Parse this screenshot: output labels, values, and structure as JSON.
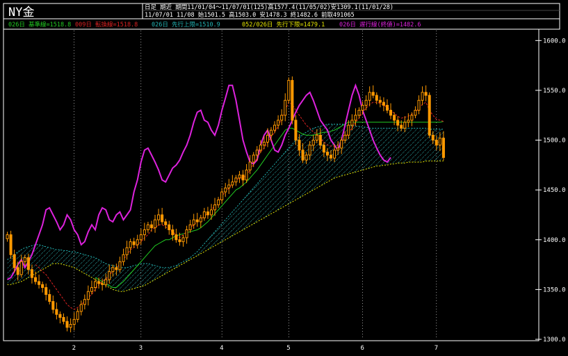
{
  "header": {
    "symbol": "NY金",
    "line1": "日足 期近 期間11/01/04～11/07/01(125)高1577.4(11/05/02)安1309.1(11/01/28)",
    "line2": "11/07/01 11/08 始1501.5 高1503.0 安1478.3 終1482.6 前取491065"
  },
  "legend": [
    {
      "text": "026日 基準線=1518.8",
      "color": "#22cc22"
    },
    {
      "text": "009日 転換線=1518.8",
      "color": "#dd2222"
    },
    {
      "text": "026日 先行上限=1510.9",
      "color": "#22b5b5"
    },
    {
      "text": "052/026日 先行下限=1479.1",
      "color": "#e6e600"
    },
    {
      "text": "026日 遅行線(終値)=1482.6",
      "color": "#dd22dd"
    }
  ],
  "colors": {
    "candle": "#ff9900",
    "kijun": "#22cc22",
    "tenkan": "#dd2222",
    "senkou_a": "#22b5b5",
    "senkou_b": "#e6e600",
    "chikou": "#dd22dd",
    "cloud": "#33bbbb",
    "axis": "#ffffff",
    "grid": "#ffffff"
  },
  "chart_data": {
    "type": "candlestick",
    "ylim": [
      1300,
      1610
    ],
    "y_ticks": [
      1300,
      1350,
      1400,
      1450,
      1500,
      1550,
      1600
    ],
    "y_tick_labels": [
      "1300.0",
      "1350.0",
      "1400.0",
      "1450.0",
      "1500.0",
      "1550.0",
      "1600.0"
    ],
    "x_ticks": [
      {
        "index": 19,
        "label": "2"
      },
      {
        "index": 38,
        "label": "3"
      },
      {
        "index": 61,
        "label": "4"
      },
      {
        "index": 80,
        "label": "5"
      },
      {
        "index": 101,
        "label": "6"
      },
      {
        "index": 122,
        "label": "7"
      }
    ],
    "total_bars": 151,
    "closes": [
      1405,
      1385,
      1372,
      1365,
      1378,
      1382,
      1370,
      1362,
      1358,
      1355,
      1352,
      1345,
      1338,
      1330,
      1325,
      1322,
      1318,
      1312,
      1315,
      1320,
      1328,
      1335,
      1340,
      1348,
      1352,
      1358,
      1356,
      1355,
      1360,
      1368,
      1372,
      1370,
      1378,
      1385,
      1392,
      1398,
      1395,
      1400,
      1405,
      1410,
      1415,
      1412,
      1420,
      1425,
      1418,
      1415,
      1410,
      1405,
      1400,
      1398,
      1402,
      1410,
      1415,
      1420,
      1418,
      1422,
      1428,
      1425,
      1430,
      1435,
      1440,
      1448,
      1452,
      1455,
      1458,
      1462,
      1465,
      1460,
      1470,
      1478,
      1485,
      1490,
      1495,
      1498,
      1505,
      1510,
      1515,
      1520,
      1525,
      1540,
      1560,
      1520,
      1500,
      1490,
      1480,
      1485,
      1495,
      1500,
      1505,
      1495,
      1488,
      1485,
      1482,
      1490,
      1492,
      1500,
      1505,
      1515,
      1520,
      1525,
      1530,
      1535,
      1540,
      1548,
      1545,
      1540,
      1538,
      1535,
      1530,
      1525,
      1520,
      1515,
      1512,
      1518,
      1520,
      1525,
      1530,
      1540,
      1548,
      1545,
      1505,
      1500,
      1495,
      1502,
      1482.6
    ],
    "tenkan": [
      null,
      null,
      null,
      null,
      null,
      null,
      null,
      null,
      1375,
      1372,
      1368,
      1365,
      1360,
      1355,
      1350,
      1345,
      1340,
      1335,
      1332,
      1330,
      1332,
      1335,
      1338,
      1342,
      1345,
      1350,
      1355,
      1358,
      1360,
      1365,
      1368,
      1372,
      1375,
      1380,
      1385,
      1390,
      1392,
      1395,
      1398,
      1402,
      1405,
      1410,
      1412,
      1415,
      1415,
      1413,
      1410,
      1408,
      1405,
      1402,
      1405,
      1408,
      1412,
      1415,
      1418,
      1420,
      1424,
      1426,
      1430,
      1434,
      1438,
      1444,
      1448,
      1452,
      1456,
      1460,
      1462,
      1462,
      1465,
      1470,
      1476,
      1482,
      1488,
      1492,
      1498,
      1503,
      1508,
      1514,
      1522,
      1530,
      1538,
      1536,
      1530,
      1525,
      1520,
      1515,
      1512,
      1508,
      1506,
      1502,
      1498,
      1495,
      1494,
      1494,
      1495,
      1498,
      1502,
      1508,
      1512,
      1518,
      1522,
      1528,
      1532,
      1536,
      1538,
      1538,
      1537,
      1535,
      1533,
      1530,
      1527,
      1524,
      1522,
      1523,
      1524,
      1526,
      1528,
      1532,
      1536,
      1538,
      1530,
      1525,
      1521,
      1520,
      1518.8
    ],
    "kijun": [
      null,
      null,
      null,
      null,
      null,
      null,
      null,
      null,
      null,
      null,
      null,
      null,
      null,
      null,
      null,
      null,
      null,
      null,
      null,
      null,
      null,
      null,
      null,
      null,
      null,
      1362,
      1360,
      1358,
      1356,
      1354,
      1352,
      1352,
      1355,
      1358,
      1362,
      1366,
      1370,
      1374,
      1378,
      1382,
      1386,
      1390,
      1394,
      1396,
      1398,
      1400,
      1400,
      1402,
      1404,
      1405,
      1406,
      1407,
      1408,
      1409,
      1410,
      1412,
      1415,
      1418,
      1422,
      1426,
      1430,
      1434,
      1438,
      1442,
      1446,
      1450,
      1452,
      1455,
      1458,
      1462,
      1466,
      1470,
      1475,
      1480,
      1485,
      1490,
      1495,
      1500,
      1505,
      1510,
      1512,
      1512,
      1510,
      1508,
      1506,
      1505,
      1505,
      1505,
      1506,
      1507,
      1508,
      1508,
      1509,
      1510,
      1512,
      1514,
      1516,
      1518,
      1518,
      1518,
      1518,
      1518,
      1518,
      1518,
      1518,
      1518,
      1518,
      1518,
      1518,
      1518,
      1518,
      1518,
      1518,
      1518,
      1518,
      1518,
      1518,
      1518,
      1518,
      1518,
      1518,
      1518,
      1518,
      1518,
      1518.8
    ],
    "senkou_a": [
      1380,
      1382,
      1385,
      1388,
      1390,
      1392,
      1393,
      1394,
      1395,
      1395,
      1394,
      1393,
      1392,
      1391,
      1390,
      1390,
      1389,
      1389,
      1388,
      1388,
      1387,
      1386,
      1385,
      1384,
      1383,
      1382,
      1380,
      1378,
      1376,
      1375,
      1374,
      1373,
      1372,
      1372,
      1372,
      1373,
      1374,
      1375,
      1376,
      1376,
      1376,
      1375,
      1374,
      1373,
      1372,
      1372,
      1372,
      1373,
      1374,
      1376,
      1378,
      1380,
      1382,
      1385,
      1388,
      1392,
      1396,
      1400,
      1404,
      1408,
      1412,
      1416,
      1420,
      1424,
      1428,
      1432,
      1436,
      1440,
      1444,
      1448,
      1452,
      1456,
      1460,
      1464,
      1468,
      1472,
      1476,
      1480,
      1484,
      1488,
      1492,
      1496,
      1500,
      1503,
      1506,
      1508,
      1510,
      1512,
      1513,
      1514,
      1515,
      1516,
      1516,
      1516,
      1516,
      1516,
      1516,
      1515,
      1515,
      1514,
      1514,
      1513,
      1513,
      1512,
      1512,
      1512,
      1512,
      1512,
      1512,
      1512,
      1512,
      1512,
      1512,
      1512,
      1512,
      1512,
      1512,
      1512,
      1512,
      1512,
      1511,
      1511,
      1511,
      1511,
      1510.9
    ],
    "senkou_b": [
      1355,
      1355,
      1356,
      1357,
      1358,
      1360,
      1362,
      1364,
      1366,
      1368,
      1370,
      1372,
      1374,
      1376,
      1376,
      1376,
      1375,
      1374,
      1373,
      1372,
      1370,
      1368,
      1366,
      1364,
      1362,
      1360,
      1358,
      1356,
      1354,
      1352,
      1350,
      1349,
      1348,
      1348,
      1349,
      1350,
      1351,
      1352,
      1353,
      1354,
      1356,
      1358,
      1360,
      1362,
      1364,
      1366,
      1368,
      1370,
      1372,
      1374,
      1376,
      1378,
      1380,
      1382,
      1384,
      1386,
      1388,
      1390,
      1392,
      1394,
      1396,
      1398,
      1400,
      1402,
      1404,
      1406,
      1408,
      1410,
      1412,
      1414,
      1416,
      1418,
      1420,
      1422,
      1424,
      1426,
      1428,
      1430,
      1432,
      1434,
      1436,
      1438,
      1440,
      1442,
      1444,
      1446,
      1448,
      1450,
      1452,
      1454,
      1456,
      1458,
      1460,
      1462,
      1463,
      1464,
      1465,
      1466,
      1467,
      1468,
      1469,
      1470,
      1471,
      1472,
      1473,
      1474,
      1474,
      1475,
      1475,
      1476,
      1476,
      1477,
      1477,
      1477,
      1478,
      1478,
      1478,
      1478,
      1478,
      1479,
      1479,
      1479,
      1479,
      1479,
      1479.1
    ],
    "chikou": [
      1360,
      1362,
      1368,
      1375,
      1380,
      1372,
      1378,
      1385,
      1395,
      1405,
      1415,
      1430,
      1432,
      1425,
      1418,
      1410,
      1415,
      1425,
      1420,
      1410,
      1405,
      1395,
      1398,
      1408,
      1415,
      1410,
      1425,
      1432,
      1430,
      1420,
      1418,
      1425,
      1428,
      1420,
      1425,
      1430,
      1448,
      1460,
      1478,
      1490,
      1492,
      1485,
      1478,
      1470,
      1460,
      1458,
      1465,
      1472,
      1475,
      1480,
      1488,
      1495,
      1505,
      1518,
      1528,
      1530,
      1520,
      1518,
      1510,
      1505,
      1515,
      1530,
      1542,
      1555,
      1555,
      1540,
      1520,
      1500,
      1488,
      1478,
      1476,
      1480,
      1495,
      1505,
      1510,
      1500,
      1490,
      1488,
      1495,
      1505,
      1512,
      1520,
      1528,
      1535,
      1540,
      1545,
      1548,
      1540,
      1530,
      1520,
      1515,
      1510,
      1500,
      1495,
      1490,
      1500,
      1515,
      1530,
      1545,
      1555,
      1545,
      1530,
      1520,
      1510,
      1500,
      1492,
      1485,
      1480,
      1478,
      1482.6
    ]
  }
}
